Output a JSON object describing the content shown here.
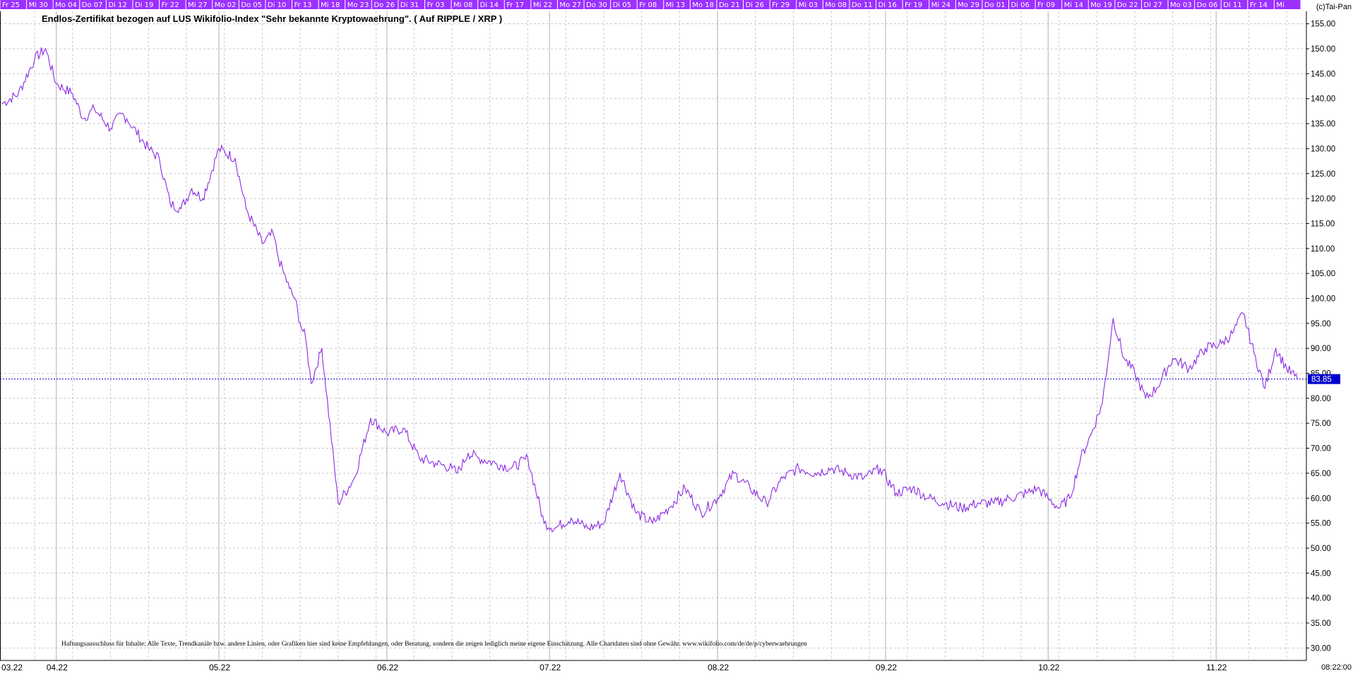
{
  "copyright": "(c)Tai-Pan",
  "timestamp": "08:22:00",
  "disclaimer": "Haftungsausschluss für Inhalte: Alle Texte, Trendkanäle bzw. andere Linien, oder Grafiken hier sind keine Empfehlungen, oder Beratung, sondern die zeigen lediglich meine eigene Einschätzung. Alle Chartdaten sind ohne Gewähr.  www.wikifolio.com/de/de/p/cyberwaehrungen",
  "colors": {
    "series": "#8a2be2",
    "tab_bg": "#9b30ff",
    "grid": "#c8c8c8",
    "last_line": "#0000cc",
    "last_label_bg": "#0000cc"
  },
  "chart_data": {
    "type": "line",
    "title": "Endlos-Zertifikat bezogen auf LUS Wikifolio-Index \"Sehr bekannte Kryptowaehrung\". ( Auf RIPPLE / XRP )",
    "xlabel": "",
    "ylabel": "",
    "ylim": [
      27.5,
      157.5
    ],
    "y_ticks": [
      "30.00",
      "35.00",
      "40.00",
      "45.00",
      "50.00",
      "55.00",
      "60.00",
      "65.00",
      "70.00",
      "75.00",
      "80.00",
      "85.00",
      "90.00",
      "95.00",
      "100.00",
      "105.00",
      "110.00",
      "115.00",
      "120.00",
      "125.00",
      "130.00",
      "135.00",
      "140.00",
      "145.00",
      "150.00",
      "155.00"
    ],
    "grid": true,
    "last_value": 83.85,
    "last_value_label": "83.85",
    "month_labels": [
      "03.22",
      "04.22",
      "05.22",
      "06.22",
      "07.22",
      "08.22",
      "09.22",
      "10.22",
      "11.22"
    ],
    "day_tabs": [
      "Fr 25",
      "Mi 30",
      "Mo 04",
      "Do 07",
      "Di 12",
      "Di 19",
      "Fr 22",
      "Mi 27",
      "Mo 02",
      "Do 05",
      "Di 10",
      "Fr 13",
      "Mi 18",
      "Mo 23",
      "Do 26",
      "Di 31",
      "Fr 03",
      "Mi 08",
      "Di 14",
      "Fr 17",
      "Mi 22",
      "Mo 27",
      "Do 30",
      "Di 05",
      "Fr 08",
      "Mi 13",
      "Mo 18",
      "Do 21",
      "Di 26",
      "Fr 29",
      "Mi 03",
      "Mo 08",
      "Do 11",
      "Di 16",
      "Fr 19",
      "Mi 24",
      "Mo 29",
      "Do 01",
      "Di 06",
      "Fr 09",
      "Mi 14",
      "Mo 19",
      "Do 22",
      "Di 27",
      "Mo 03",
      "Do 06",
      "Di 11",
      "Fr 14",
      "Mi"
    ],
    "series": [
      {
        "x": [
          "2022-03-22",
          "2022-03-25",
          "2022-03-28",
          "2022-03-30",
          "2022-04-01",
          "2022-04-04",
          "2022-04-06",
          "2022-04-08",
          "2022-04-11",
          "2022-04-13",
          "2022-04-14",
          "2022-04-18",
          "2022-04-20",
          "2022-04-22",
          "2022-04-24",
          "2022-04-26",
          "2022-04-28",
          "2022-05-01",
          "2022-05-04",
          "2022-05-06",
          "2022-05-09",
          "2022-05-11",
          "2022-05-12",
          "2022-05-13",
          "2022-05-14",
          "2022-05-15",
          "2022-05-16",
          "2022-05-17",
          "2022-05-18",
          "2022-05-20",
          "2022-05-23",
          "2022-05-26",
          "2022-05-29",
          "2022-06-01",
          "2022-06-04",
          "2022-06-07",
          "2022-06-10",
          "2022-06-13",
          "2022-06-14",
          "2022-06-16",
          "2022-06-18",
          "2022-06-21",
          "2022-06-24",
          "2022-06-27",
          "2022-06-30",
          "2022-07-02",
          "2022-07-05",
          "2022-07-08",
          "2022-07-11",
          "2022-07-14",
          "2022-07-17",
          "2022-07-20",
          "2022-07-23",
          "2022-07-26",
          "2022-07-29",
          "2022-08-01",
          "2022-08-04",
          "2022-08-07",
          "2022-08-10",
          "2022-08-13",
          "2022-08-16",
          "2022-08-19",
          "2022-08-22",
          "2022-08-25",
          "2022-08-28",
          "2022-08-31",
          "2022-09-03",
          "2022-09-06",
          "2022-09-09",
          "2022-09-12",
          "2022-09-15",
          "2022-09-18",
          "2022-09-21",
          "2022-09-24",
          "2022-09-27",
          "2022-09-29",
          "2022-10-01",
          "2022-10-03",
          "2022-10-05",
          "2022-10-07",
          "2022-10-09",
          "2022-10-11",
          "2022-10-13",
          "2022-10-15",
          "2022-10-17",
          "2022-10-19",
          "2022-10-21",
          "2022-10-24",
          "2022-10-27",
          "2022-10-30",
          "2022-11-02",
          "2022-11-04",
          "2022-11-06",
          "2022-11-08",
          "2022-11-10",
          "2022-11-12",
          "2022-11-14",
          "2022-11-16"
        ],
        "values": [
          139,
          141,
          148,
          150,
          143,
          141,
          136,
          138,
          134,
          137,
          136,
          130,
          128,
          119,
          118,
          122,
          120,
          130,
          128,
          118,
          111,
          113,
          108,
          105,
          102,
          100,
          95,
          92,
          83,
          90,
          59,
          64,
          76,
          73,
          74,
          68,
          67,
          66,
          65,
          69,
          68,
          67,
          66,
          68,
          55,
          54,
          56,
          54,
          55,
          65,
          57,
          55,
          58,
          62,
          57,
          60,
          65,
          62,
          59,
          64,
          66,
          65,
          66,
          65,
          64,
          66,
          61,
          62,
          60,
          59,
          58,
          59,
          59,
          60,
          61,
          62,
          60,
          58,
          60,
          68,
          73,
          79,
          96,
          88,
          85,
          80,
          82,
          88,
          86,
          90,
          91,
          93,
          97,
          89,
          82,
          90,
          86,
          83.85
        ]
      }
    ]
  }
}
